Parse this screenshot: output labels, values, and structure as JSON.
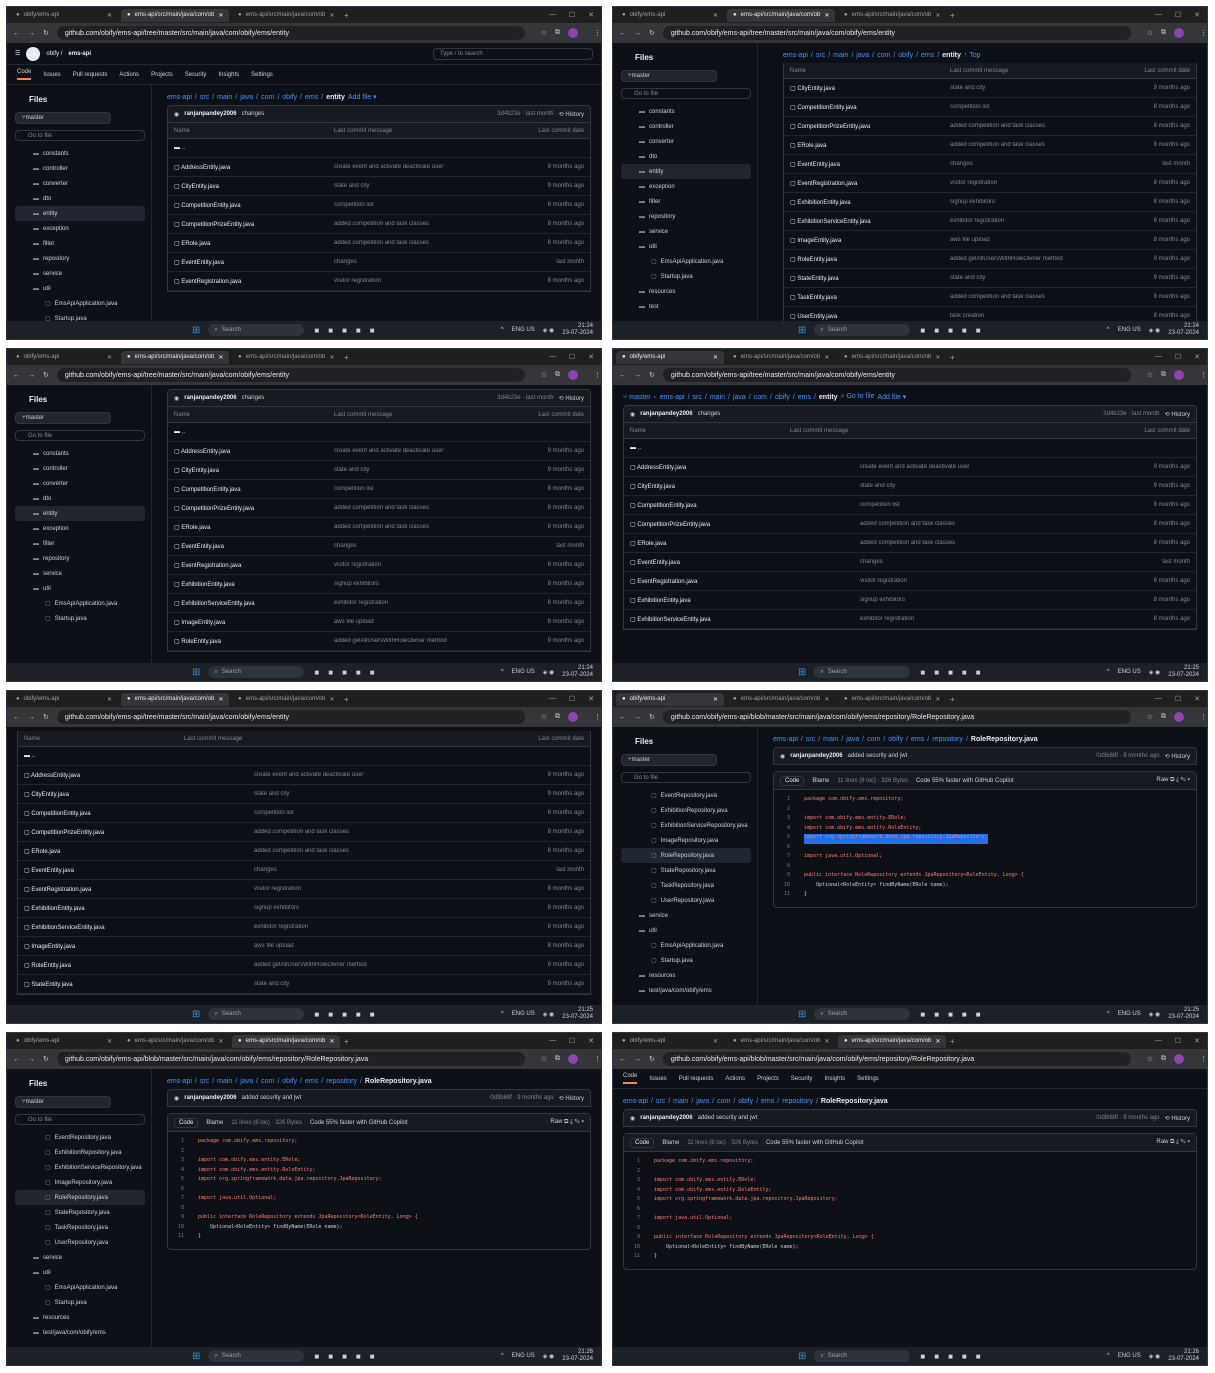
{
  "browser": {
    "tab_labels": [
      "obify/ems-api",
      "ems-api/src/main/java/com/ob",
      "ems-api/src/main/java/com/ob"
    ],
    "url_tree": "github.com/obify/ems-api/tree/master/src/main/java/com/obify/ems/entity",
    "url_blob": "github.com/obify/ems-api/blob/master/src/main/java/com/obify/ems/repository/RoleRepository.java"
  },
  "github": {
    "owner": "obify",
    "repo": "ems-api",
    "search_placeholder": "Type / to search",
    "nav": [
      "Code",
      "Issues",
      "Pull requests",
      "Actions",
      "Projects",
      "Security",
      "Insights",
      "Settings"
    ],
    "files_title": "Files",
    "branch": "master",
    "goto_placeholder": "Go to file",
    "add_file": "Add file",
    "history": "History",
    "top": "Top"
  },
  "entity_view": {
    "breadcrumb": [
      "ems-api",
      "src",
      "main",
      "java",
      "com",
      "obify",
      "ems",
      "entity"
    ],
    "commit_user": "ranjanpandey2006",
    "commit_msg": "changes",
    "commit_meta": "3d4b23e · last month",
    "columns": [
      "Name",
      "Last commit message",
      "Last commit date"
    ],
    "parent": "..",
    "files": [
      {
        "name": "AddressEntity.java",
        "msg": "create event and activate deactivate user",
        "date": "9 months ago"
      },
      {
        "name": "CityEntity.java",
        "msg": "state and city",
        "date": "9 months ago"
      },
      {
        "name": "CompetitionEntity.java",
        "msg": "competition list",
        "date": "8 months ago"
      },
      {
        "name": "CompetitionPrizeEntity.java",
        "msg": "added competition and task classes",
        "date": "8 months ago"
      },
      {
        "name": "ERole.java",
        "msg": "added competition and task classes",
        "date": "8 months ago"
      },
      {
        "name": "EventEntity.java",
        "msg": "changes",
        "date": "last month"
      },
      {
        "name": "EventRegistration.java",
        "msg": "visitor registration",
        "date": "8 months ago"
      },
      {
        "name": "ExhibitionEntity.java",
        "msg": "signup exhibitors",
        "date": "8 months ago"
      },
      {
        "name": "ExhibitionServiceEntity.java",
        "msg": "exhibitor registration",
        "date": "8 months ago"
      },
      {
        "name": "ImageEntity.java",
        "msg": "aws file upload",
        "date": "8 months ago"
      },
      {
        "name": "RoleEntity.java",
        "msg": "added getAllUsersWithRoleOwner method",
        "date": "9 months ago"
      },
      {
        "name": "StateEntity.java",
        "msg": "state and city",
        "date": "9 months ago"
      },
      {
        "name": "TaskEntity.java",
        "msg": "added competition and task classes",
        "date": "8 months ago"
      },
      {
        "name": "UserEntity.java",
        "msg": "task creation",
        "date": "8 months ago"
      }
    ],
    "tree": [
      "constants",
      "controller",
      "converter",
      "dto",
      "entity",
      "exception",
      "filter",
      "repository",
      "service",
      "util",
      "EmsApiApplication.java",
      "Startup.java",
      "resources",
      "test"
    ]
  },
  "repo_view": {
    "breadcrumb": [
      "ems-api",
      "src",
      "main",
      "java",
      "com",
      "obify",
      "ems",
      "repository",
      "RoleRepository.java"
    ],
    "commit_user": "ranjanpandey2006",
    "commit_msg": "added security and jwt",
    "commit_meta": "0d3b69f · 9 months ago",
    "tab_code": "Code",
    "tab_blame": "Blame",
    "meta": "11 lines (8 loc) · 326 Bytes",
    "copilot": "Code 55% faster with GitHub Copilot",
    "raw": "Raw",
    "tree": [
      "EventRepository.java",
      "ExhibitionRepository.java",
      "ExhibitionServiceRepository.java",
      "ImageRepository.java",
      "RoleRepository.java",
      "StateRepository.java",
      "TaskRepository.java",
      "UserRepository.java",
      "service",
      "util",
      "EmsApiApplication.java",
      "Startup.java",
      "resources",
      "test/java/com/obify/ems"
    ],
    "code": [
      "package com.obify.ems.repository;",
      "",
      "import com.obify.ems.entity.ERole;",
      "import com.obify.ems.entity.RoleEntity;",
      "import org.springframework.data.jpa.repository.JpaRepository;",
      "",
      "import java.util.Optional;",
      "",
      "public interface RoleRepository extends JpaRepository<RoleEntity, Long> {",
      "    Optional<RoleEntity> findByName(ERole name);",
      "}"
    ]
  },
  "taskbar": {
    "search": "Search",
    "lang": "ENG US",
    "times": [
      "21:24",
      "21:24",
      "21:24",
      "21:25",
      "21:25",
      "21:25",
      "21:26",
      "21:26"
    ],
    "date": "23-07-2024"
  }
}
